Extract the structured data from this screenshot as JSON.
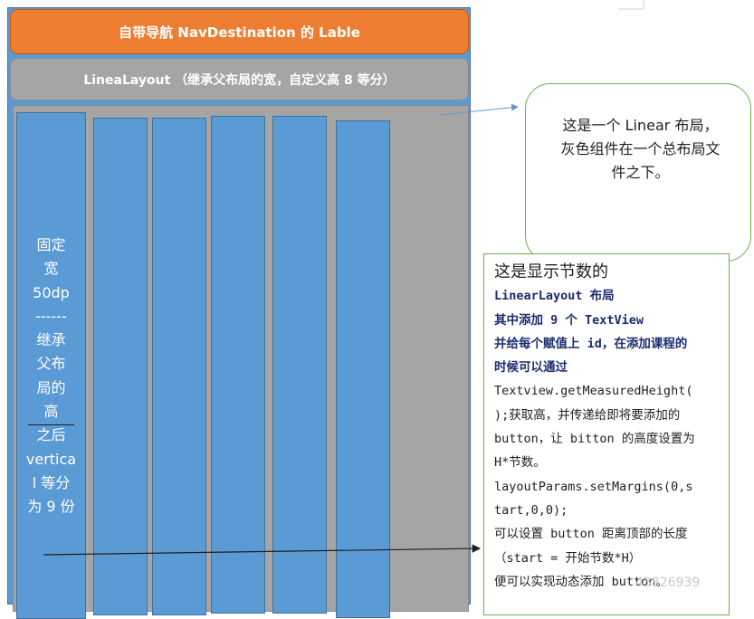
{
  "nav_bar": {
    "label": "自带导航 NavDestination 的 Lable"
  },
  "linear_bar": {
    "label": "LineaLayout （继承父布局的宽，自定义高 8 等分）"
  },
  "fixed_column": {
    "lines": [
      "固定",
      "宽",
      "50dp",
      "------",
      "继承",
      "父布",
      "局的",
      "高",
      "之后",
      "vertica",
      "l 等分",
      "为 9 份"
    ]
  },
  "callout": {
    "lines": [
      "这是一个 Linear 布局，",
      "灰色组件在一个总布局文",
      "件之下。"
    ]
  },
  "description": {
    "head": "这是显示节数的",
    "bold_lines": [
      "LinearLayout 布局",
      "其中添加 9 个 TextView",
      "并给每个赋值上 id，在添加课程的",
      "时候可以通过"
    ],
    "lines": [
      "Textview.getMeasuredHeight(",
      ");获取高，并传递给即将要添加的",
      "button，让 bitton 的高度设置为",
      "H*节数。",
      "layoutParams.setMargins(0,s",
      "tart,0,0);",
      "可以设置 button 距离顶部的长度",
      "（start = 开始节数*H）",
      "便可以实现动态添加 button。"
    ]
  },
  "watermark": "43826939",
  "colors": {
    "blue": "#5b9bd5",
    "orange": "#ed7d31",
    "gray": "#a5a5a5",
    "green": "#70ad47"
  }
}
